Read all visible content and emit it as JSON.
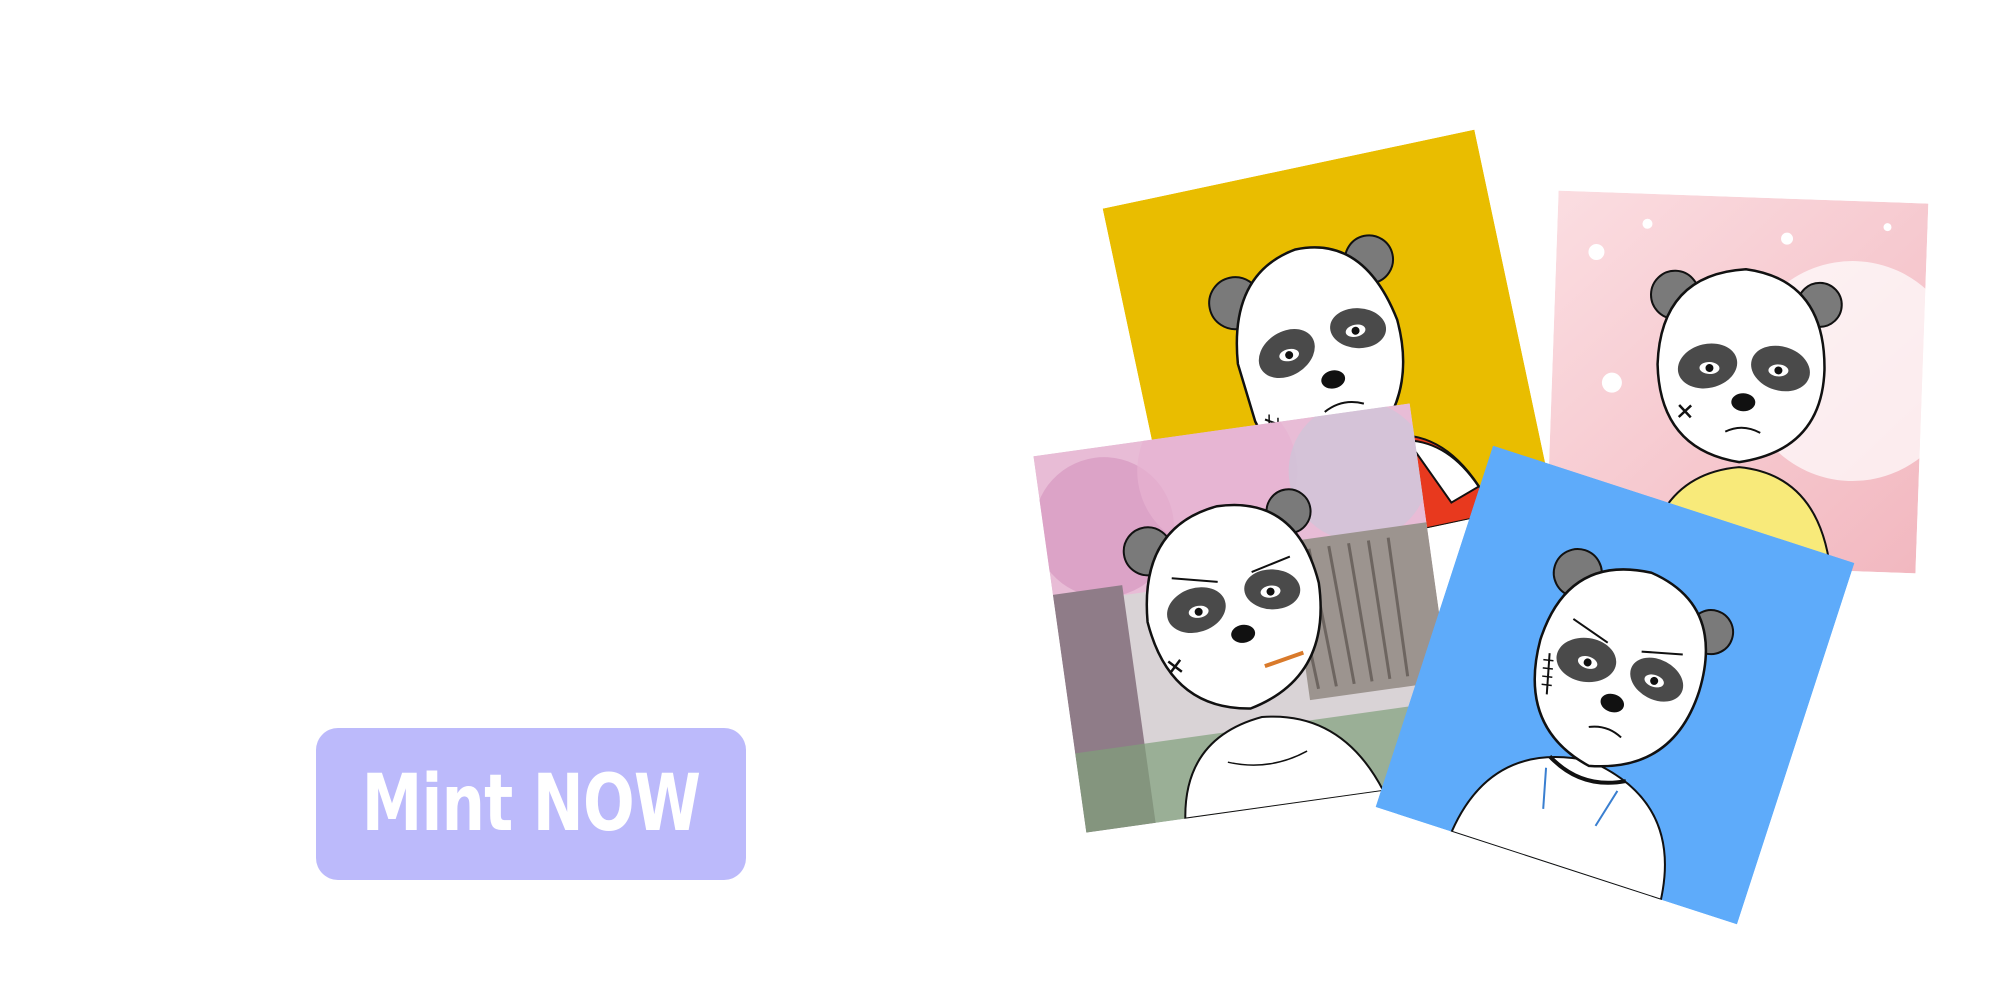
{
  "cta": {
    "label": "Mint NOW",
    "color": "#bcbafb"
  },
  "gallery": {
    "cards": [
      {
        "id": "yellow",
        "background": "#e9bd00",
        "shirt": "#e8391e"
      },
      {
        "id": "pink",
        "background": "#f6c9cf",
        "shirt": "#f8ea7a"
      },
      {
        "id": "sakura",
        "background": "#d9c6d8",
        "shirt": "#ffffff"
      },
      {
        "id": "blue",
        "background": "#5eabfa",
        "shirt": "#ffffff"
      }
    ]
  }
}
